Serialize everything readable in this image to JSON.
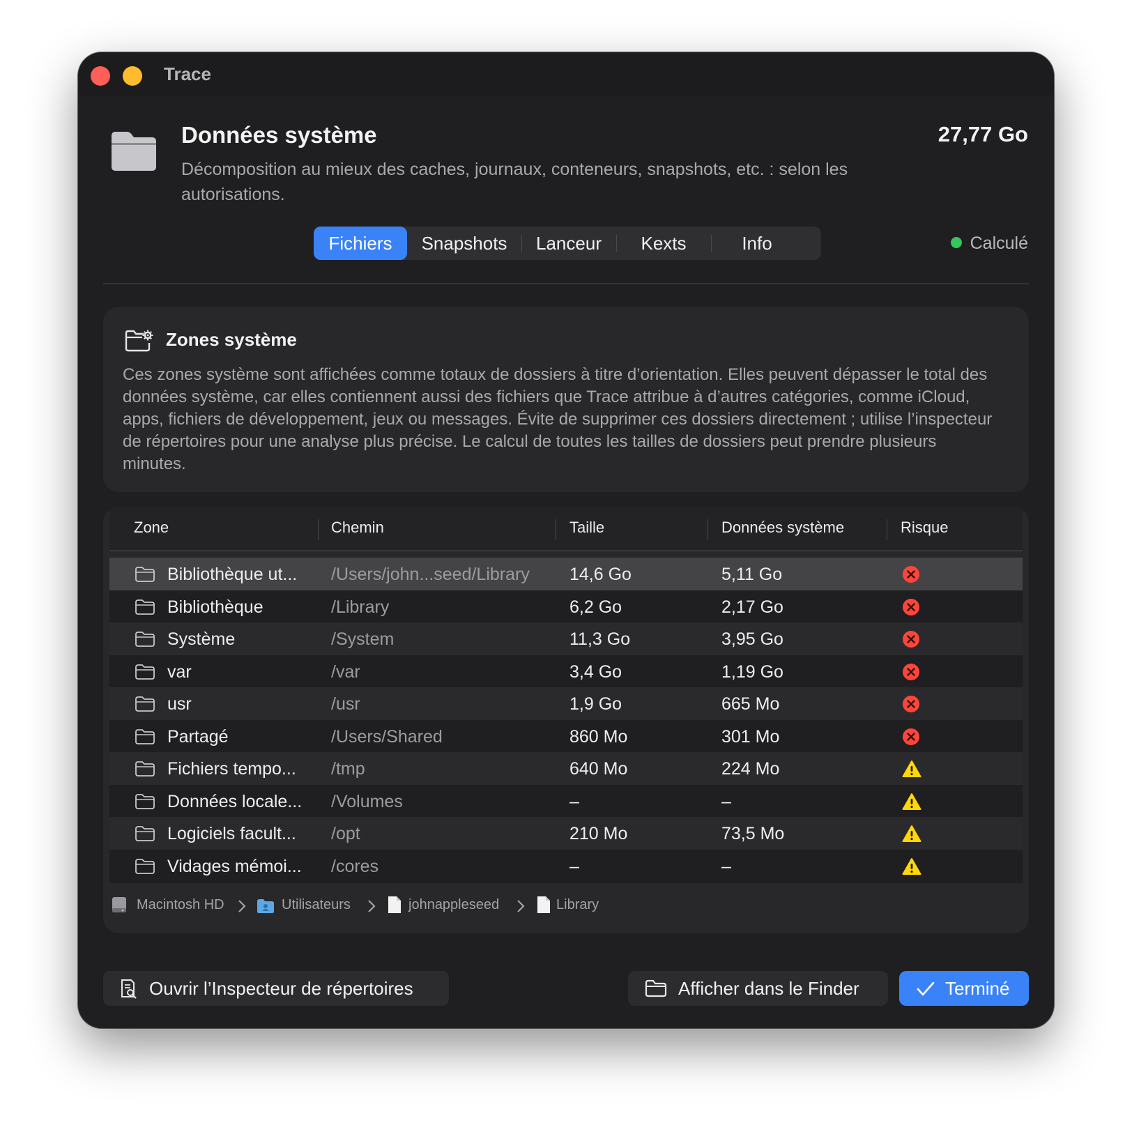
{
  "window": {
    "title": "Trace"
  },
  "header": {
    "title": "Données système",
    "size": "27,77 Go",
    "description": "Décomposition au mieux des caches, journaux, conteneurs, snapshots, etc. : selon les autorisations."
  },
  "tabs": [
    {
      "label": "Fichiers",
      "active": true
    },
    {
      "label": "Snapshots",
      "active": false
    },
    {
      "label": "Lanceur",
      "active": false
    },
    {
      "label": "Kexts",
      "active": false
    },
    {
      "label": "Info",
      "active": false
    }
  ],
  "status": {
    "label": "Calculé",
    "color": "#34c759"
  },
  "info_card": {
    "icon": "folder-gear-icon",
    "title": "Zones système",
    "text": "Ces zones système sont affichées comme totaux de dossiers à titre d’orientation. Elles peuvent dépasser le total des données système, car elles contiennent aussi des fichiers que Trace attribue à d’autres catégories, comme iCloud, apps, fichiers de développement, jeux ou messages. Évite de supprimer ces dossiers directement ; utilise l’inspecteur de répertoires pour une analyse plus précise. Le calcul de toutes les tailles de dossiers peut prendre plusieurs minutes."
  },
  "table": {
    "columns": [
      "Zone",
      "Chemin",
      "Taille",
      "Données système",
      "Risque"
    ],
    "rows": [
      {
        "zone": "Bibliothèque ut...",
        "path": "/Users/john...seed/Library",
        "taille": "14,6 Go",
        "sys": "5,11 Go",
        "risk": "high",
        "selected": true
      },
      {
        "zone": "Bibliothèque",
        "path": "/Library",
        "taille": "6,2 Go",
        "sys": "2,17 Go",
        "risk": "high"
      },
      {
        "zone": "Système",
        "path": "/System",
        "taille": "11,3 Go",
        "sys": "3,95 Go",
        "risk": "high"
      },
      {
        "zone": "var",
        "path": "/var",
        "taille": "3,4 Go",
        "sys": "1,19 Go",
        "risk": "high"
      },
      {
        "zone": "usr",
        "path": "/usr",
        "taille": "1,9 Go",
        "sys": "665 Mo",
        "risk": "high"
      },
      {
        "zone": "Partagé",
        "path": "/Users/Shared",
        "taille": "860 Mo",
        "sys": "301 Mo",
        "risk": "high"
      },
      {
        "zone": "Fichiers tempo...",
        "path": "/tmp",
        "taille": "640 Mo",
        "sys": "224 Mo",
        "risk": "warning"
      },
      {
        "zone": "Données locale...",
        "path": "/Volumes",
        "taille": "–",
        "sys": "–",
        "risk": "warning"
      },
      {
        "zone": "Logiciels facult...",
        "path": "/opt",
        "taille": "210 Mo",
        "sys": "73,5 Mo",
        "risk": "warning"
      },
      {
        "zone": "Vidages mémoi...",
        "path": "/cores",
        "taille": "–",
        "sys": "–",
        "risk": "warning"
      }
    ]
  },
  "breadcrumb": [
    {
      "label": "Macintosh HD",
      "icon": "disk-icon"
    },
    {
      "label": "Utilisateurs",
      "icon": "users-folder-icon"
    },
    {
      "label": "johnappleseed",
      "icon": "document-icon"
    },
    {
      "label": "Library",
      "icon": "document-icon"
    }
  ],
  "buttons": {
    "inspect": "Ouvrir l’Inspecteur de répertoires",
    "finder": "Afficher dans le Finder",
    "done": "Terminé"
  },
  "colors": {
    "accent": "#3a82f7",
    "risk_high": "#ff453a",
    "risk_warning": "#ffd60a",
    "window_bg": "#1f1f21"
  }
}
